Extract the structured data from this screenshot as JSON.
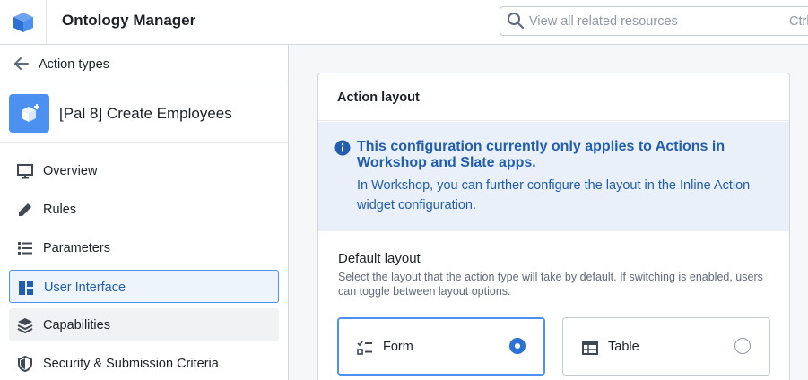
{
  "app": {
    "title": "Ontology Manager",
    "logo_icon": "cube-icon"
  },
  "search": {
    "placeholder": "View all related resources",
    "shortcut": "Ctrl"
  },
  "sidebar": {
    "back_label": "Action types",
    "entity_name": "[Pal 8] Create Employees",
    "entity_icon": "cube-add-icon",
    "items": [
      {
        "label": "Overview",
        "icon": "desktop-icon"
      },
      {
        "label": "Rules",
        "icon": "edit-icon"
      },
      {
        "label": "Parameters",
        "icon": "list-icon"
      },
      {
        "label": "User Interface",
        "icon": "layout-icon",
        "active": true
      },
      {
        "label": "Capabilities",
        "icon": "layers-icon"
      },
      {
        "label": "Security & Submission Criteria",
        "icon": "shield-icon"
      }
    ]
  },
  "main": {
    "card_title": "Action layout",
    "callout_title": "This configuration currently only applies to Actions in Workshop and Slate apps.",
    "callout_body": "In Workshop, you can further configure the layout in the Inline Action widget configuration.",
    "default_layout_label": "Default layout",
    "default_layout_help": "Select the layout that the action type will take by default. If switching is enabled, users can toggle between layout options.",
    "options": [
      {
        "label": "Form",
        "icon": "form-icon",
        "selected": true
      },
      {
        "label": "Table",
        "icon": "table-icon",
        "selected": false
      }
    ]
  },
  "colors": {
    "accent": "#2d72d2",
    "callout_bg": "#e9f0f9",
    "callout_text": "#215db0",
    "active_bg": "#eef4fb"
  }
}
